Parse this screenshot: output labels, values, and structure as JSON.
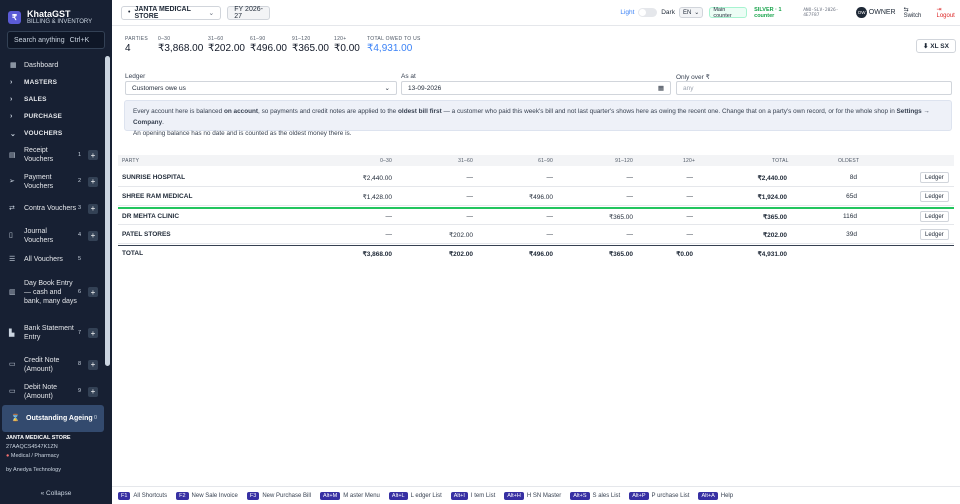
{
  "brand": {
    "logo": "₹",
    "name": "KhataGST",
    "subtitle": "BILLING & INVENTORY"
  },
  "search": {
    "placeholder": "Search anything",
    "shortcut": "Ctrl+K"
  },
  "nav": {
    "dashboard": "Dashboard",
    "masters": "MASTERS",
    "sales": "SALES",
    "purchase": "PURCHASE",
    "vouchers": "VOUCHERS",
    "items": [
      {
        "label": "Receipt Vouchers",
        "num": "1"
      },
      {
        "label": "Payment Vouchers",
        "num": "2"
      },
      {
        "label": "Contra Vouchers",
        "num": "3"
      },
      {
        "label": "Journal Vouchers",
        "num": "4"
      },
      {
        "label": "All Vouchers",
        "num": "5"
      },
      {
        "label": "Day Book Entry — cash and bank, many days",
        "num": "6"
      },
      {
        "label": "Bank Statement Entry",
        "num": "7"
      },
      {
        "label": "Credit Note (Amount)",
        "num": "8"
      },
      {
        "label": "Debit Note (Amount)",
        "num": "9"
      },
      {
        "label": "Outstanding Ageing",
        "num": "0"
      }
    ]
  },
  "sidebar_footer": {
    "store": "JANTA MEDICAL STORE",
    "gstin": "27AAQCS4547K1ZN",
    "category": "Medical / Pharmacy",
    "credit": "by Anedya Technology",
    "collapse": "« Collapse"
  },
  "topbar": {
    "store": "JANTA MEDICAL STORE",
    "fy": "FY 2026-27",
    "light": "Light",
    "dark": "Dark",
    "lang": "EN",
    "counter": "Main counter",
    "license": "SILVER · 1 counter",
    "license_code": "ANO-SLV-2026-4E7F87",
    "role_badge": "OW",
    "role": "OWNER",
    "switch": "Switch",
    "logout": "Logout"
  },
  "kpis": [
    {
      "label": "PARTIES",
      "value": "4"
    },
    {
      "label": "0–30",
      "value": "₹3,868.00"
    },
    {
      "label": "31–60",
      "value": "₹202.00"
    },
    {
      "label": "61–90",
      "value": "₹496.00"
    },
    {
      "label": "91–120",
      "value": "₹365.00"
    },
    {
      "label": "120+",
      "value": "₹0.00"
    },
    {
      "label": "TOTAL OWED TO US",
      "value": "₹4,931.00"
    }
  ],
  "export": "⬇ XL SX",
  "filters": {
    "ledger_label": "Ledger",
    "ledger_value": "Customers owe us",
    "asat_label": "As at",
    "asat_value": "13-09-2026",
    "only_over_label": "Only over ₹",
    "only_over_placeholder": "any"
  },
  "info": {
    "t1": "Every account here is balanced ",
    "b1": "on account",
    "t2": ", so payments and credit notes are applied to the ",
    "b2": "oldest bill first",
    "t3": " — a customer who paid this week's bill and not last quarter's shows here as owing the recent one. Change that on a party's own record, or for the whole shop in ",
    "b3": "Settings → Company",
    "t4": ".",
    "line2": "An opening balance has no date and is counted as the oldest money there is."
  },
  "table": {
    "headers": [
      "PARTY",
      "0–30",
      "31–60",
      "61–90",
      "91–120",
      "120+",
      "TOTAL",
      "OLDEST"
    ],
    "rows": [
      {
        "party": "SUNRISE HOSPITAL",
        "b1": "₹2,440.00",
        "b2": "—",
        "b3": "—",
        "b4": "—",
        "b5": "—",
        "total": "₹2,440.00",
        "oldest": "8d",
        "action": "Ledger"
      },
      {
        "party": "SHREE RAM MEDICAL",
        "b1": "₹1,428.00",
        "b2": "—",
        "b3": "₹496.00",
        "b4": "—",
        "b5": "—",
        "total": "₹1,924.00",
        "oldest": "65d",
        "action": "Ledger"
      },
      {
        "party": "DR MEHTA CLINIC",
        "b1": "—",
        "b2": "—",
        "b3": "—",
        "b4": "₹365.00",
        "b5": "—",
        "total": "₹365.00",
        "oldest": "116d",
        "action": "Ledger"
      },
      {
        "party": "PATEL STORES",
        "b1": "—",
        "b2": "₹202.00",
        "b3": "—",
        "b4": "—",
        "b5": "—",
        "total": "₹202.00",
        "oldest": "39d",
        "action": "Ledger"
      }
    ],
    "total": {
      "label": "TOTAL",
      "b1": "₹3,868.00",
      "b2": "₹202.00",
      "b3": "₹496.00",
      "b4": "₹365.00",
      "b5": "₹0.00",
      "total": "₹4,931.00"
    }
  },
  "shortcuts": [
    {
      "key": "F1",
      "label": "All Shortcuts"
    },
    {
      "key": "F2",
      "label": "New Sale Invoice"
    },
    {
      "key": "F3",
      "label": "New Purchase Bill"
    },
    {
      "key": "Alt+M",
      "label": "M aster Menu"
    },
    {
      "key": "Alt+L",
      "label": "L edger List"
    },
    {
      "key": "Alt+I",
      "label": "I tem List"
    },
    {
      "key": "Alt+H",
      "label": "H SN Master"
    },
    {
      "key": "Alt+S",
      "label": "S ales List"
    },
    {
      "key": "Alt+P",
      "label": "P urchase List"
    },
    {
      "key": "Alt+A",
      "label": "Help"
    }
  ],
  "colors": {
    "accent": "#5b5bd6",
    "sidebar": "#172033",
    "blue": "#3b82f6",
    "green": "#22c55e"
  }
}
